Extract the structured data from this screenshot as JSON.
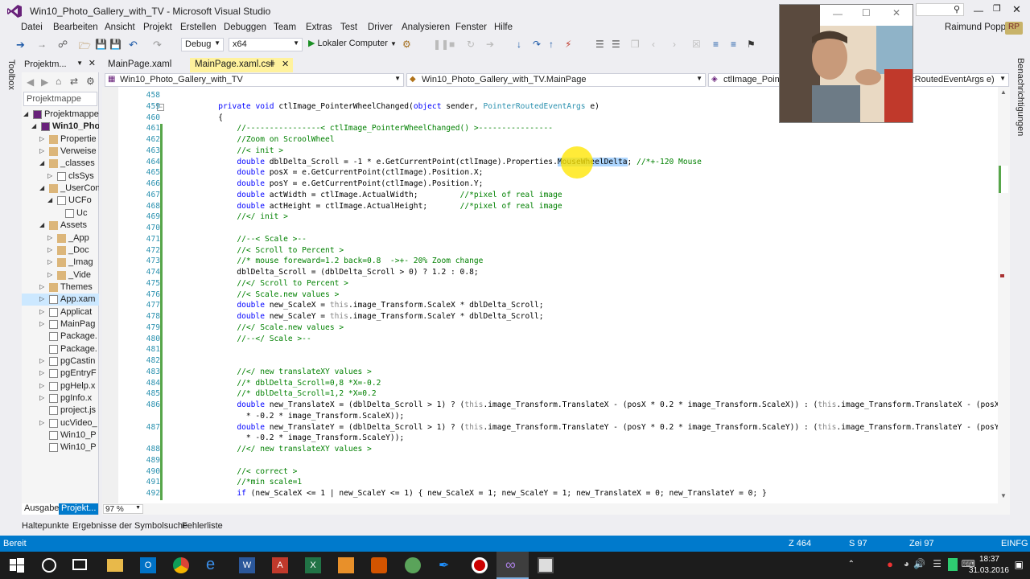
{
  "window": {
    "title": "Win10_Photo_Gallery_with_TV - Microsoft Visual Studio",
    "user": "Raimund Popp",
    "user_initials": "RP",
    "quick_launch_placeholder": ""
  },
  "menu": [
    "Datei",
    "Bearbeiten",
    "Ansicht",
    "Projekt",
    "Erstellen",
    "Debuggen",
    "Team",
    "Extras",
    "Test",
    "Driver",
    "Analysieren",
    "Fenster",
    "Hilfe"
  ],
  "toolbar": {
    "config": "Debug",
    "platform": "x64",
    "run_label": "Lokaler Computer"
  },
  "toolbox_label": "Toolbox",
  "notifications_label": "Benachrichtigungen",
  "solution_explorer": {
    "title": "Projektm...",
    "search_placeholder": "Projektmappe",
    "items": [
      {
        "label": "Projektmappe \"",
        "indent": 0,
        "expanded": true
      },
      {
        "label": "Win10_Pho",
        "indent": 1,
        "expanded": true,
        "bold": true
      },
      {
        "label": "Propertie",
        "indent": 2,
        "expanded": false
      },
      {
        "label": "Verweise",
        "indent": 2,
        "expanded": false
      },
      {
        "label": "_classes",
        "indent": 2,
        "expanded": true
      },
      {
        "label": "clsSys",
        "indent": 3,
        "expanded": false
      },
      {
        "label": "_UserCon",
        "indent": 2,
        "expanded": true
      },
      {
        "label": "UCFo",
        "indent": 3,
        "expanded": true
      },
      {
        "label": "Uc",
        "indent": 4,
        "expanded": null
      },
      {
        "label": "Assets",
        "indent": 2,
        "expanded": true
      },
      {
        "label": "_App",
        "indent": 3,
        "expanded": false
      },
      {
        "label": "_Doc",
        "indent": 3,
        "expanded": false
      },
      {
        "label": "_Imag",
        "indent": 3,
        "expanded": false
      },
      {
        "label": "_Vide",
        "indent": 3,
        "expanded": false
      },
      {
        "label": "Themes",
        "indent": 2,
        "expanded": false
      },
      {
        "label": "App.xam",
        "indent": 2,
        "expanded": false,
        "selected": true
      },
      {
        "label": "Applicat",
        "indent": 2,
        "expanded": false
      },
      {
        "label": "MainPag",
        "indent": 2,
        "expanded": false
      },
      {
        "label": "Package.",
        "indent": 2,
        "expanded": null
      },
      {
        "label": "Package.",
        "indent": 2,
        "expanded": null
      },
      {
        "label": "pgCastin",
        "indent": 2,
        "expanded": false
      },
      {
        "label": "pgEntryF",
        "indent": 2,
        "expanded": false
      },
      {
        "label": "pgHelp.x",
        "indent": 2,
        "expanded": false
      },
      {
        "label": "pgInfo.x",
        "indent": 2,
        "expanded": false
      },
      {
        "label": "project.js",
        "indent": 2,
        "expanded": null
      },
      {
        "label": "ucVideo_",
        "indent": 2,
        "expanded": false
      },
      {
        "label": "Win10_P",
        "indent": 2,
        "expanded": null
      },
      {
        "label": "Win10_P",
        "indent": 2,
        "expanded": null
      }
    ],
    "tabs": [
      "Ausgabe",
      "Projekt..."
    ]
  },
  "doc_tabs": [
    {
      "label": "MainPage.xaml",
      "active": false
    },
    {
      "label": "MainPage.xaml.cs",
      "active": true
    }
  ],
  "nav": {
    "project": "Win10_Photo_Gallery_with_TV",
    "type": "Win10_Photo_Gallery_with_TV.MainPage",
    "member": "ctlImage_Pointe",
    "member_tail": "rRoutedEventArgs e)"
  },
  "code_lines": [
    {
      "n": "458",
      "t": ""
    },
    {
      "n": "459",
      "t": "        private void ctlImage_PointerWheelChanged(object sender, PointerRoutedEventArgs e)"
    },
    {
      "n": "460",
      "t": "        {"
    },
    {
      "n": "461",
      "t": "            //----------------< ctlImage_PointerWheelChanged() >----------------"
    },
    {
      "n": "462",
      "t": "            //Zoom on ScroolWheel"
    },
    {
      "n": "463",
      "t": "            //< init >"
    },
    {
      "n": "464",
      "t": "            double dblDelta_Scroll = -1 * e.GetCurrentPoint(ctlImage).Properties.MouseWheelDelta; //*+-120 Mouse"
    },
    {
      "n": "465",
      "t": "            double posX = e.GetCurrentPoint(ctlImage).Position.X;"
    },
    {
      "n": "466",
      "t": "            double posY = e.GetCurrentPoint(ctlImage).Position.Y;"
    },
    {
      "n": "467",
      "t": "            double actWidth = ctlImage.ActualWidth;         //*pixel of real image"
    },
    {
      "n": "468",
      "t": "            double actHeight = ctlImage.ActualHeight;       //*pixel of real image"
    },
    {
      "n": "469",
      "t": "            //</ init >"
    },
    {
      "n": "470",
      "t": ""
    },
    {
      "n": "471",
      "t": "            //--< Scale >--"
    },
    {
      "n": "472",
      "t": "            //< Scroll to Percent >"
    },
    {
      "n": "473",
      "t": "            //* mouse foreward=1.2 back=0.8  ->+- 20% Zoom change"
    },
    {
      "n": "474",
      "t": "            dblDelta_Scroll = (dblDelta_Scroll > 0) ? 1.2 : 0.8;"
    },
    {
      "n": "475",
      "t": "            //</ Scroll to Percent >"
    },
    {
      "n": "476",
      "t": "            //< Scale.new values >"
    },
    {
      "n": "477",
      "t": "            double new_ScaleX = this.image_Transform.ScaleX * dblDelta_Scroll;"
    },
    {
      "n": "478",
      "t": "            double new_ScaleY = this.image_Transform.ScaleY * dblDelta_Scroll;"
    },
    {
      "n": "479",
      "t": "            //</ Scale.new values >"
    },
    {
      "n": "480",
      "t": "            //--</ Scale >--"
    },
    {
      "n": "481",
      "t": ""
    },
    {
      "n": "482",
      "t": ""
    },
    {
      "n": "483",
      "t": "            //</ new translateXY values >"
    },
    {
      "n": "484",
      "t": "            //* dblDelta_Scroll=0,8 *X=-0.2"
    },
    {
      "n": "485",
      "t": "            //* dblDelta_Scroll=1,2 *X=0.2"
    },
    {
      "n": "486",
      "t": "            double new_TranslateX = (dblDelta_Scroll > 1) ? (this.image_Transform.TranslateX - (posX * 0.2 * image_Transform.ScaleX)) : (this.image_Transform.TranslateX - (posX"
    },
    {
      "n": "",
      "t": "              * -0.2 * image_Transform.ScaleX));"
    },
    {
      "n": "487",
      "t": "            double new_TranslateY = (dblDelta_Scroll > 1) ? (this.image_Transform.TranslateY - (posY * 0.2 * image_Transform.ScaleY)) : (this.image_Transform.TranslateY - (posY"
    },
    {
      "n": "",
      "t": "              * -0.2 * image_Transform.ScaleY));"
    },
    {
      "n": "488",
      "t": "            //</ new translateXY values >"
    },
    {
      "n": "489",
      "t": ""
    },
    {
      "n": "490",
      "t": "            //< correct >"
    },
    {
      "n": "491",
      "t": "            //*min scale=1"
    },
    {
      "n": "492",
      "t": "            if (new_ScaleX <= 1 | new_ScaleY <= 1) { new_ScaleX = 1; new_ScaleY = 1; new_TranslateX = 0; new_TranslateY = 0; }"
    }
  ],
  "zoom": "97 %",
  "bottom_tabs": [
    "Haltepunkte",
    "Ergebnisse der Symbolsuche",
    "Fehlerliste"
  ],
  "status": {
    "state": "Bereit",
    "line": "Z 464",
    "col": "S 97",
    "char": "Zei 97",
    "mode": "EINFG"
  },
  "taskbar": {
    "time": "18:37",
    "date": "31.03.2016"
  },
  "colors": {
    "accent": "#007acc",
    "vs_purple": "#68217a",
    "comment": "#008000",
    "keyword": "#0000ff",
    "type": "#2b91af"
  }
}
